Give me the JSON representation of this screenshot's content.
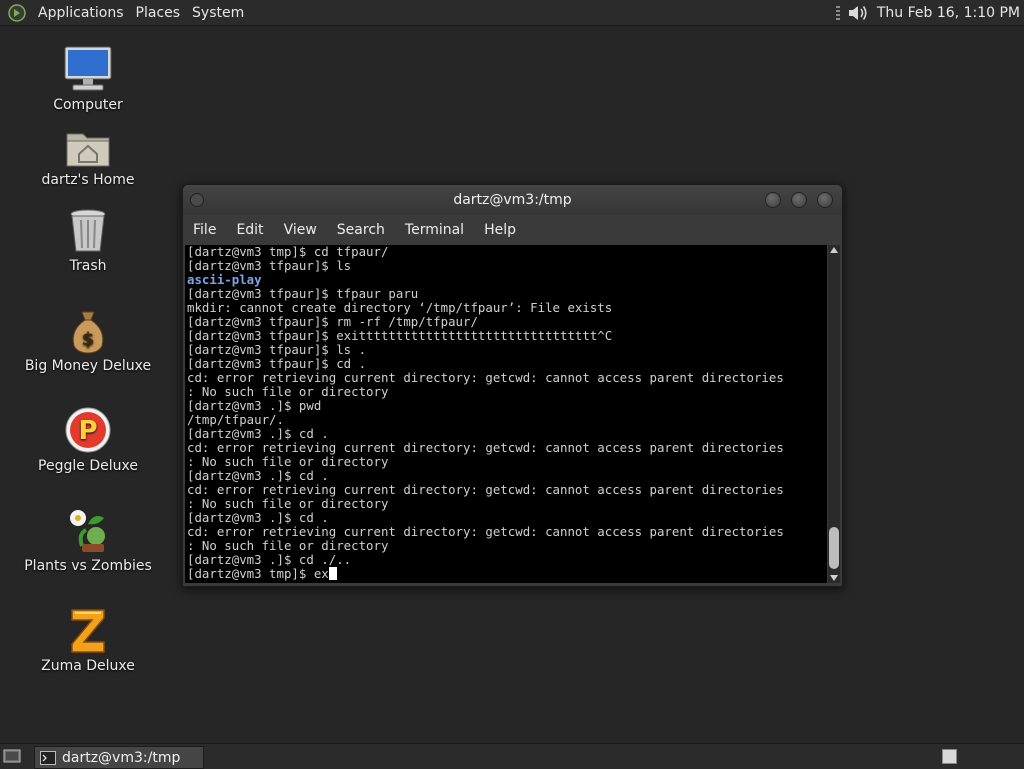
{
  "top_panel": {
    "menus": [
      "Applications",
      "Places",
      "System"
    ],
    "clock": "Thu Feb 16,  1:10 PM"
  },
  "desktop_icons": [
    {
      "label": "Computer",
      "icon": "computer-icon"
    },
    {
      "label": "dartz's Home",
      "icon": "home-folder-icon"
    },
    {
      "label": "Trash",
      "icon": "trash-icon"
    },
    {
      "label": "Big Money Deluxe",
      "icon": "money-bag-icon"
    },
    {
      "label": "Peggle Deluxe",
      "icon": "peggle-icon"
    },
    {
      "label": "Plants vs Zombies",
      "icon": "plants-vs-zombies-icon"
    },
    {
      "label": "Zuma Deluxe",
      "icon": "zuma-icon"
    }
  ],
  "terminal": {
    "title": "dartz@vm3:/tmp",
    "menus": [
      "File",
      "Edit",
      "View",
      "Search",
      "Terminal",
      "Help"
    ],
    "lines": [
      "[dartz@vm3 tmp]$ cd tfpaur/",
      "[dartz@vm3 tfpaur]$ ls",
      "ascii-play",
      "[dartz@vm3 tfpaur]$ tfpaur paru",
      "mkdir: cannot create directory ‘/tmp/tfpaur’: File exists",
      "[dartz@vm3 tfpaur]$ rm -rf /tmp/tfpaur/",
      "[dartz@vm3 tfpaur]$ exitttttttttttttttttttttttttttttttt^C",
      "[dartz@vm3 tfpaur]$ ls .",
      "[dartz@vm3 tfpaur]$ cd .",
      "cd: error retrieving current directory: getcwd: cannot access parent directories",
      ": No such file or directory",
      "[dartz@vm3 .]$ pwd",
      "/tmp/tfpaur/.",
      "[dartz@vm3 .]$ cd .",
      "cd: error retrieving current directory: getcwd: cannot access parent directories",
      ": No such file or directory",
      "[dartz@vm3 .]$ cd .",
      "cd: error retrieving current directory: getcwd: cannot access parent directories",
      ": No such file or directory",
      "[dartz@vm3 .]$ cd .",
      "cd: error retrieving current directory: getcwd: cannot access parent directories",
      ": No such file or directory",
      "[dartz@vm3 .]$ cd ./..",
      "[dartz@vm3 tmp]$ ex"
    ],
    "directory_line_index": 2
  },
  "taskbar": {
    "tasks": [
      {
        "label": "dartz@vm3:/tmp",
        "icon": "terminal-icon"
      }
    ]
  }
}
